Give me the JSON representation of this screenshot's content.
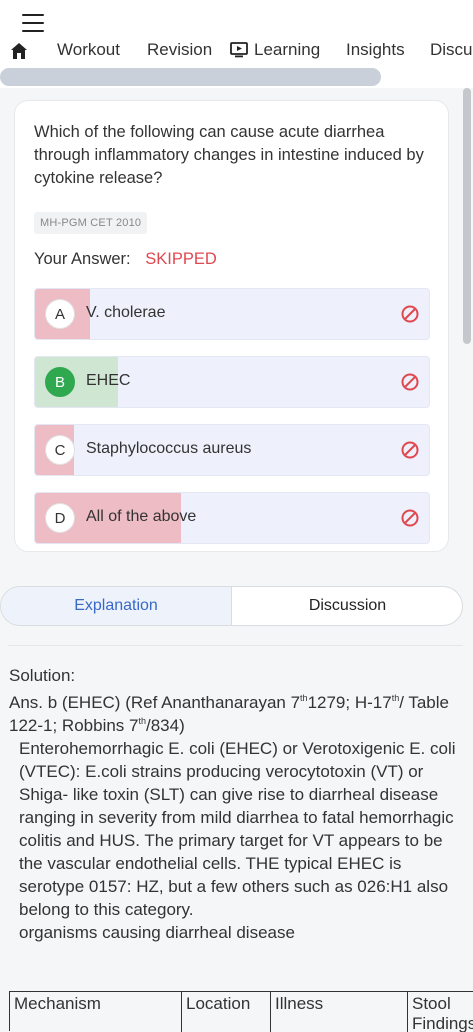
{
  "header": {
    "menu_icon": "hamburger-icon",
    "home_icon": "home-icon",
    "tabs": [
      {
        "label": "Workout"
      },
      {
        "label": "Revision"
      },
      {
        "label": "Learning",
        "icon": "video-screen-icon"
      },
      {
        "label": "Insights"
      },
      {
        "label": "Discu"
      }
    ]
  },
  "question": {
    "text": "Which of the following can cause acute diarrhea through inflammatory changes in intestine induced by cytokine release?",
    "source": "MH-PGM CET 2010",
    "your_answer_label": "Your Answer:",
    "your_answer_value": "SKIPPED",
    "options": [
      {
        "letter": "A",
        "text": "V. cholerae",
        "percent": 14,
        "correct": false,
        "icon": "ban-icon"
      },
      {
        "letter": "B",
        "text": "EHEC",
        "percent": 21,
        "correct": true,
        "icon": "ban-icon"
      },
      {
        "letter": "C",
        "text": "Staphylococcus aureus",
        "percent": 10,
        "correct": false,
        "icon": "ban-icon"
      },
      {
        "letter": "D",
        "text": "All of the above",
        "percent": 37,
        "correct": false,
        "icon": "ban-icon"
      }
    ]
  },
  "segments": {
    "explanation": "Explanation",
    "discussion": "Discussion"
  },
  "solution": {
    "label": "Solution:",
    "answer_line": {
      "a": "Ans. b (EHEC) (Ref Ananthanarayan 7",
      "a_sup": "th",
      "b": "1279; H-17",
      "b_sup": "th",
      "c": "/ Table 122-1; Robbins 7",
      "c_sup": "th",
      "d": "/834)"
    },
    "paragraph": "Enterohemorrhagic E. coli (EHEC) or Verotoxigenic E. coli (VTEC): E.coli strains producing verocytotoxin (VT) or Shiga- like toxin (SLT) can give rise to diarrheal disease ranging in severity from mild diarrhea to fatal hemorrhagic colitis and HUS. The primary target for VT appears to be the vascular endothelial cells. THE typical EHEC is serotype 0157: HZ, but a few others such as 026:H1 also belong to this category.",
    "table_caption": "organisms causing diarrheal disease",
    "table_headers": [
      "Mechanism",
      "Location",
      "Illness",
      "Stool Findings"
    ]
  },
  "colors": {
    "wrong_fill": "#edbcc4",
    "correct_fill": "#cfe6d2",
    "accent": "#3868c8",
    "skipped": "#e04850",
    "correct_badge": "#2fa84f"
  }
}
